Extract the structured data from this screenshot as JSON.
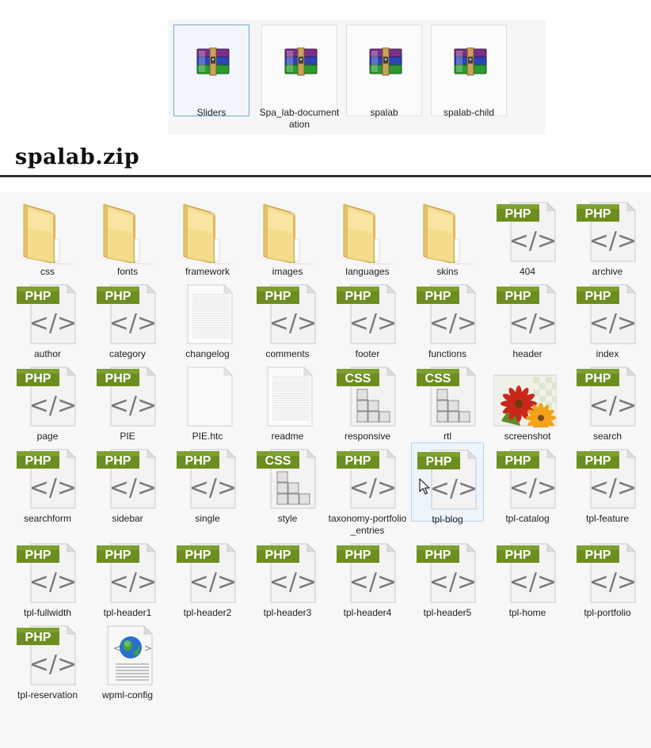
{
  "archives": [
    {
      "name": "Sliders",
      "selected": true,
      "icon": "winrar-archive-icon"
    },
    {
      "name": "Spa_lab-documentation",
      "selected": false,
      "icon": "winrar-archive-icon"
    },
    {
      "name": "spalab",
      "selected": false,
      "icon": "winrar-archive-icon"
    },
    {
      "name": "spalab-child",
      "selected": false,
      "icon": "winrar-archive-icon"
    }
  ],
  "page_title": "spalab.zip",
  "files": [
    {
      "name": "css",
      "type": "folder"
    },
    {
      "name": "fonts",
      "type": "folder"
    },
    {
      "name": "framework",
      "type": "folder"
    },
    {
      "name": "images",
      "type": "folder"
    },
    {
      "name": "languages",
      "type": "folder"
    },
    {
      "name": "skins",
      "type": "folder"
    },
    {
      "name": "404",
      "type": "php"
    },
    {
      "name": "archive",
      "type": "php"
    },
    {
      "name": "author",
      "type": "php"
    },
    {
      "name": "category",
      "type": "php"
    },
    {
      "name": "changelog",
      "type": "text"
    },
    {
      "name": "comments",
      "type": "php"
    },
    {
      "name": "footer",
      "type": "php"
    },
    {
      "name": "functions",
      "type": "php"
    },
    {
      "name": "header",
      "type": "php"
    },
    {
      "name": "index",
      "type": "php"
    },
    {
      "name": "page",
      "type": "php"
    },
    {
      "name": "PIE",
      "type": "php"
    },
    {
      "name": "PIE.htc",
      "type": "blank"
    },
    {
      "name": "readme",
      "type": "text"
    },
    {
      "name": "responsive",
      "type": "css"
    },
    {
      "name": "rtl",
      "type": "css"
    },
    {
      "name": "screenshot",
      "type": "image"
    },
    {
      "name": "search",
      "type": "php"
    },
    {
      "name": "searchform",
      "type": "php"
    },
    {
      "name": "sidebar",
      "type": "php"
    },
    {
      "name": "single",
      "type": "php"
    },
    {
      "name": "style",
      "type": "css"
    },
    {
      "name": "taxonomy-portfolio_entries",
      "type": "php"
    },
    {
      "name": "tpl-blog",
      "type": "php",
      "selected": true
    },
    {
      "name": "tpl-catalog",
      "type": "php"
    },
    {
      "name": "tpl-feature",
      "type": "php"
    },
    {
      "name": "tpl-fullwidth",
      "type": "php"
    },
    {
      "name": "tpl-header1",
      "type": "php"
    },
    {
      "name": "tpl-header2",
      "type": "php"
    },
    {
      "name": "tpl-header3",
      "type": "php"
    },
    {
      "name": "tpl-header4",
      "type": "php"
    },
    {
      "name": "tpl-header5",
      "type": "php"
    },
    {
      "name": "tpl-home",
      "type": "php"
    },
    {
      "name": "tpl-portfolio",
      "type": "php"
    },
    {
      "name": "tpl-reservation",
      "type": "php"
    },
    {
      "name": "wpml-config",
      "type": "xml"
    }
  ],
  "badges": {
    "php": "PHP",
    "css": "CSS"
  },
  "colors": {
    "php_badge": "#6b8e1f",
    "selection_border": "#7da2ce",
    "folder": "#f3d77e"
  }
}
